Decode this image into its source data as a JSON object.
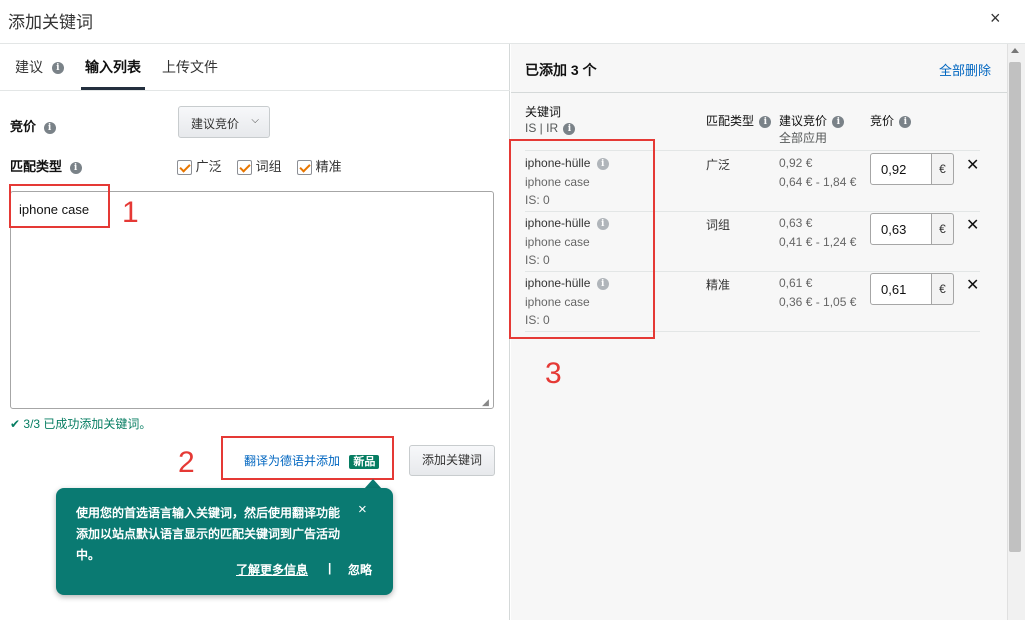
{
  "modal": {
    "title": "添加关键词",
    "close": "×"
  },
  "tabs": [
    {
      "label": "建议"
    },
    {
      "label": "输入列表"
    },
    {
      "label": "上传文件"
    }
  ],
  "bid": {
    "label": "竞价",
    "dropdown": "建议竞价"
  },
  "match": {
    "label": "匹配类型",
    "options": [
      {
        "label": "广泛",
        "checked": true
      },
      {
        "label": "词组",
        "checked": true
      },
      {
        "label": "精准",
        "checked": true
      }
    ]
  },
  "textarea": {
    "value": "iphone case"
  },
  "success_msg": "3/3 已成功添加关键词。",
  "translate": {
    "link": "翻译为德语并添加",
    "badge": "新品"
  },
  "add_button": "添加关键词",
  "tooltip": {
    "text": "使用您的首选语言输入关键词，然后使用翻译功能添加以站点默认语言显示的匹配关键词到广告活动中。",
    "learn_more": "了解更多信息",
    "sep": "|",
    "ignore": "忽略",
    "close": "×"
  },
  "annotations": {
    "n1": "1",
    "n2": "2",
    "n3": "3"
  },
  "right": {
    "title": "已添加 3 个",
    "delete_all": "全部删除",
    "headers": {
      "keyword": "关键词",
      "keyword_sub": "IS | IR",
      "match": "匹配类型",
      "suggested": "建议竞价",
      "apply_all": "全部应用",
      "bid": "竞价"
    },
    "rows": [
      {
        "keyword": "iphone-hülle",
        "original": "iphone case",
        "is": "IS: 0",
        "match": "广泛",
        "suggested": "0,92 €",
        "range": "0,64 € - 1,84 €",
        "bid": "0,92",
        "currency": "€"
      },
      {
        "keyword": "iphone-hülle",
        "original": "iphone case",
        "is": "IS: 0",
        "match": "词组",
        "suggested": "0,63 €",
        "range": "0,41 € - 1,24 €",
        "bid": "0,63",
        "currency": "€"
      },
      {
        "keyword": "iphone-hülle",
        "original": "iphone case",
        "is": "IS: 0",
        "match": "精准",
        "suggested": "0,61 €",
        "range": "0,36 € - 1,05 €",
        "bid": "0,61",
        "currency": "€"
      }
    ]
  },
  "colors": {
    "accent_link": "#0066c0",
    "teal": "#0a7a72",
    "annotation_red": "#e53935",
    "check_orange": "#e77600"
  }
}
